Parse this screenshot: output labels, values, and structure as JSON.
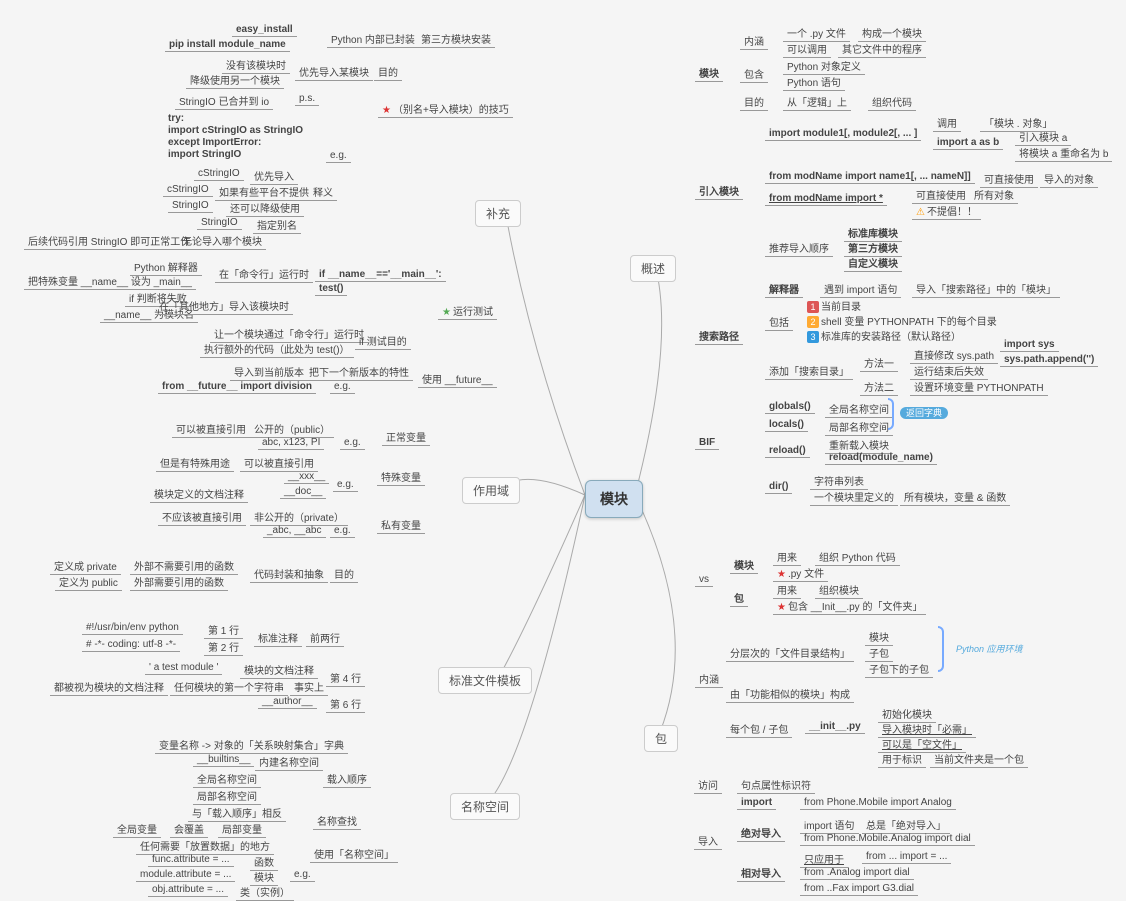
{
  "root": "模块",
  "b": {
    "bu": "补充",
    "gs": "概述",
    "zy": "作用域",
    "wj": "标准文件模板",
    "mc": "名称空间",
    "bao": "包"
  },
  "l": {
    "ei": "easy_install",
    "pip": "pip install module_name",
    "nb": "Python 内部已封装",
    "d3": "第三方模块安装",
    "mm": "没有该模块时",
    "jj": "降级使用另一个模块",
    "yx": "优先导入某模块",
    "md": "目的",
    "sio": "StringIO 已合并到 io",
    "ps": "p.s.",
    "try": "try:",
    "im1": "    import cStringIO as StringIO",
    "exc": "except ImportError:",
    "im2": "    import StringIO",
    "eg": "e.g.",
    "bm": "（别名+导入模块）的技巧",
    "cs": "cStringIO",
    "yxd": "优先导入",
    "rg": "如果有些平台不提供",
    "hk": "还可以降级使用",
    "sy": "释义",
    "zdm": "指定别名",
    "hx": "后续代码引用 StringIO 即可正常工作",
    "wl": "无论导入哪个模块",
    "jsq": "Python 解释器",
    "ml": "在「命令行」运行时",
    "ts": "把特殊变量 __name__ 设为 _main__",
    "pd": "if 判断将失败",
    "nm": "__name__ 为模块名",
    "qt": "在「其他地方」导入该模块时",
    "ifm": "if __name__=='__main__':",
    "tst": "    test()",
    "rml": "让一个模块通过「命令行」运行时",
    "zew": "执行额外的代码（此处为 test()）",
    "csm": "if 测试目的",
    "yxc": "运行测试",
    "drd": "导入到当前版本",
    "xb": "把下一个新版本的特性",
    "fut": "from __future__ import division",
    "sf": "使用 __future__",
    "kz": "可以被直接引用",
    "gk": "公开的（public）",
    "abc": "abc, x123, PI",
    "zc": "正常变量",
    "ds": "但是有特殊用途",
    "kyz": "可以被直接引用",
    "xxx": "__xxx__",
    "doc": "__doc__",
    "tsb": "特殊变量",
    "wdz": "模块定义的文档注释",
    "byg": "不应该被直接引用",
    "fgk": "非公开的（private）",
    "abc2": "_abc, __abc",
    "syb": "私有变量",
    "dyp": "定义成 private",
    "wb1": "外部不需要引用的函数",
    "dyu": "定义为 public",
    "wb2": "外部需要引用的函数",
    "dmf": "代码封装和抽象",
    "env": "#!/usr/bin/env python",
    "d1": "第 1 行",
    "cod": "# -*- coding: utf-8 -*-",
    "d2": "第 2 行",
    "bzz": "标准注释",
    "lh": "前两行",
    "atm": "' a test module '",
    "mkz": "模块的文档注释",
    "d4": "第 4 行",
    "dbs": "都被视为模块的文档注释",
    "rh": "任何模块的第一个字符串",
    "ssl": "事实上",
    "aut": "__author__",
    "d6": "第 6 行",
    "bln": "变量名称 -> 对象的「关系映射集合」",
    "zd": "字典",
    "bui": "__builtins__",
    "njm": "内建名称空间",
    "qjm": "全局名称空间",
    "jbm": "局部名称空间",
    "zrs": "载入顺序",
    "yzr": "与「载入顺序」相反",
    "mcz": "名称查找",
    "qjb": "全局变量",
    "hfg": "会覆盖",
    "jbb": "局部变量",
    "rhe": "任何需要「放置数据」的地方",
    "fn": "func.attribute = ...",
    "hs": "函数",
    "mo": "module.attribute = ...",
    "mk": "模块",
    "ob": "obj.attribute = ...",
    "lx": "类（实例）",
    "syk": "使用「名称空间」"
  },
  "r": {
    "nh": "内涵",
    "yp": "一个 .py 文件",
    "gc": "构成一个模块",
    "ky": "可以调用",
    "qt": "其它文件中的程序",
    "bh": "包含",
    "pd": "Python 对象定义",
    "yj": "Python 语句",
    "md": "目的",
    "cl": "从「逻辑」上",
    "zz": "组织代码",
    "imp": "import module1[, module2[, ... ]",
    "dy": "调用",
    "mkdx": "「模块 . 对象」",
    "iab": "import a as b",
    "yra": "引入模块 a",
    "jma": "将模块 a 重命名为 b",
    "fmn": "from modName import name1[, ... nameN]]",
    "kzj": "可直接使用",
    "dr": "导入的对象",
    "fms": "from modName import *",
    "kzs": "可直接使用",
    "syd": "所有对象",
    "bty": "不提倡！！",
    "tj": "推荐导入顺序",
    "bzk": "标准库模块",
    "dsf": "第三方模块",
    "zdy": "自定义模块",
    "yrm": "引入模块",
    "jsq": "解释器",
    "ydi": "遇到 import 语句",
    "drs": "导入「搜索路径」中的「模块」",
    "bk": "包括",
    "dq": "当前目录",
    "sh": "shell 变量 PYTHONPATH 下的每个目录",
    "bz": "标准库的安装路径（默认路径）",
    "tj2": "添加「搜索目录」",
    "ff1": "方法一",
    "zjx": "直接修改 sys.path",
    "isy": "import sys",
    "spa": "sys.path.append('')",
    "yxj": "运行结束后失效",
    "ff2": "方法二",
    "szp": "设置环境变量 PYTHONPATH",
    "ssl": "搜索路径",
    "glo": "globals()",
    "qjk": "全局名称空间",
    "loc": "locals()",
    "jbk": "局部名称空间",
    "fhz": "返回字典",
    "rel": "reload()",
    "cxz": "重新载入模块",
    "rmn": "reload(module_name)",
    "bif": "BIF",
    "dir": "dir()",
    "zfc": "字符串列表",
    "ygm": "一个模块里定义的",
    "syv": "所有模块，变量 & 函数",
    "mk": "模块",
    "yl": "用来",
    "zzp": "组织 Python 代码",
    "pyf": ".py 文件",
    "bo": "包",
    "zzm": "组织模块",
    "bhi": "包含 __Init__.py 的「文件夹」",
    "vs": "vs",
    "fcj": "分层次的「文件目录结构」",
    "zb": "子包",
    "zbx": "子包下的子包",
    "pyy": "Python 应用环境",
    "nhb": "内涵",
    "ygn": "由「功能相似的模块」构成",
    "mgb": "每个包 / 子包",
    "ini": "__init__.py",
    "csh": "初始化模块",
    "drm": "导入模块时「必需」",
    "kys": "可以是「空文件」",
    "ybs": "用于标识",
    "dqm": "当前文件夹是一个包",
    "fw": "访问",
    "jd": "句点属性标识符",
    "dru": "导入",
    "imp2": "import",
    "fpm": "from Phone.Mobile import Analog",
    "jdd": "绝对导入",
    "iyj": "import 语句",
    "zsd": "总是「绝对导入」",
    "fpm2": "from Phone.Mobile.Analog import dial",
    "xdd": "相对导入",
    "zry": "只应用于",
    "fmi": "from ... import = ...",
    "fad": "from .Analog import dial",
    "ffd": "from ..Fax import G3.dial"
  }
}
